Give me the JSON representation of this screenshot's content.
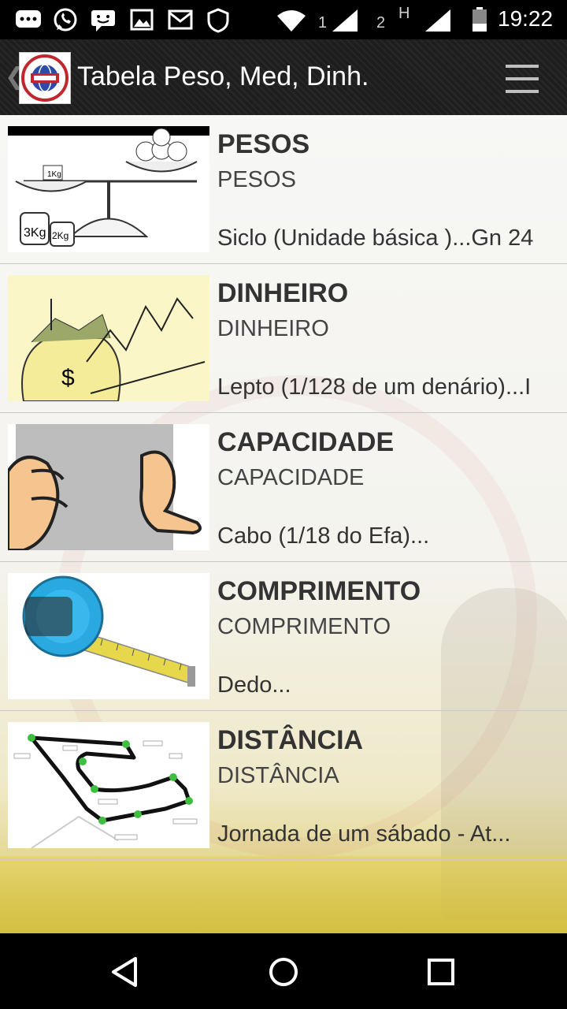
{
  "status_bar": {
    "sim1_label": "1",
    "sim2_label": "2",
    "network_type": "H",
    "time": "19:22",
    "icons": [
      "messages-icon",
      "whatsapp-icon",
      "chat-icon",
      "gallery-icon",
      "mail-icon",
      "shield-icon",
      "wifi-icon",
      "signal-icon",
      "battery-icon"
    ]
  },
  "action_bar": {
    "title": "Tabela Peso, Med, Dinh.",
    "icons": [
      "back-chevron-icon",
      "app-logo",
      "menu-icon"
    ]
  },
  "list": [
    {
      "title": "PESOS",
      "subtitle": "PESOS",
      "description": "Siclo (Unidade básica )...Gn 24",
      "image": "balance-scale-image"
    },
    {
      "title": "DINHEIRO",
      "subtitle": "DINHEIRO",
      "description": "Lepto (1/128 de um denário)...I",
      "image": "money-bag-chart-image"
    },
    {
      "title": "CAPACIDADE",
      "subtitle": "CAPACIDADE",
      "description": "Cabo (1/18 do Efa)...",
      "image": "hand-gesture-image"
    },
    {
      "title": "COMPRIMENTO",
      "subtitle": "COMPRIMENTO",
      "description": "Dedo...",
      "image": "tape-measure-image"
    },
    {
      "title": "DISTÂNCIA",
      "subtitle": "DISTÂNCIA",
      "description": "Jornada de um sábado - At...",
      "image": "race-track-map-image"
    }
  ],
  "nav_bar": {
    "icons": [
      "back-triangle-icon",
      "home-circle-icon",
      "recents-square-icon"
    ]
  }
}
